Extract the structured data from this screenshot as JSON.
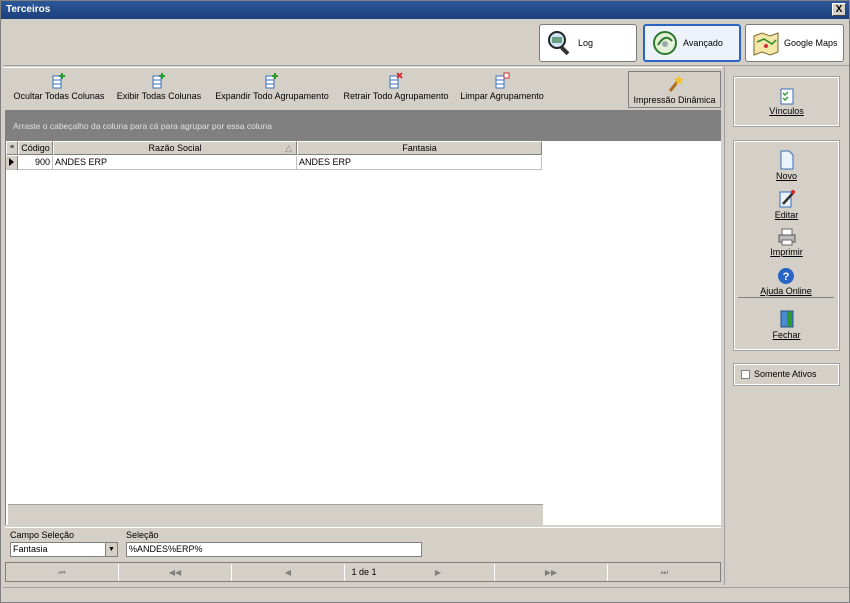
{
  "window": {
    "title": "Terceiros",
    "close_label": "X"
  },
  "topbar": {
    "log_label": "Log",
    "avancado_label": "Avançado",
    "maps_label": "Google Maps"
  },
  "toolbar": {
    "hide_cols": "Ocultar Todas Colunas",
    "show_cols": "Exibir Todas  Colunas",
    "expand_group": "Expandir Todo Agrupamento",
    "collapse_group": "Retrair Todo Agrupamento",
    "clear_group": "Limpar Agrupamento",
    "dynamic_print": "Impressão Dinâmica"
  },
  "grid": {
    "group_hint": "Arraste o cabeçalho da coluna para cá para agrupar por essa coluna",
    "columns": [
      "Código",
      "Razão Social",
      "Fantasia"
    ],
    "sort_indicator": "△",
    "rows": [
      {
        "codigo": "900",
        "razao": "ANDES ERP",
        "fantasia": "ANDES ERP"
      }
    ]
  },
  "filter": {
    "campo_label": "Campo Seleção",
    "campo_value": "Fantasia",
    "selecao_label": "Seleção",
    "selecao_value": "%ANDES%ERP%"
  },
  "pager": {
    "first": "⏮",
    "prev_page": "◀◀",
    "prev": "◀",
    "page_indicator": "1 de 1",
    "next": "▶",
    "next_page": "▶▶",
    "last": "⏭"
  },
  "sidebar": {
    "vinculos": "Vínculos",
    "novo": "Novo",
    "editar": "Editar",
    "imprimir": "Imprimir",
    "ajuda": "Ajuda Online",
    "fechar": "Fechar",
    "somente_ativos": "Somente Ativos"
  }
}
